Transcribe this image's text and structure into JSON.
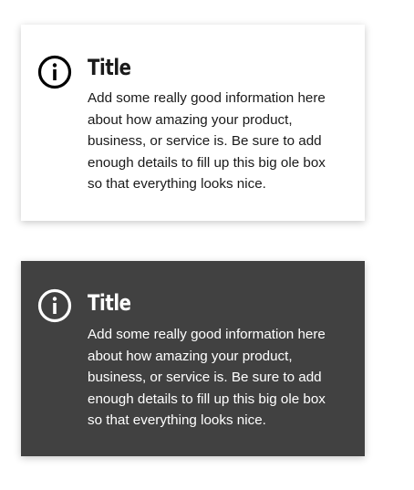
{
  "cards": [
    {
      "theme": "light",
      "background": "#ffffff",
      "icon": "info-circle-icon",
      "title": "Title",
      "body": "Add some really good information here\nabout how amazing your product,\nbusiness, or service is. Be sure to add\nenough details to fill up this big ole box\nso that everything looks nice."
    },
    {
      "theme": "dark",
      "background": "#414141",
      "icon": "info-circle-icon",
      "title": "Title",
      "body": "Add some really good information here\nabout how amazing your product,\nbusiness, or service is. Be sure to add\nenough details to fill up this big ole box\nso that everything looks nice."
    }
  ]
}
